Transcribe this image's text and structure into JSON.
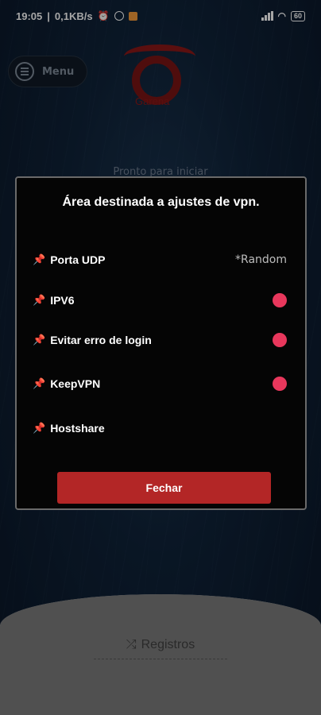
{
  "status_bar": {
    "time": "19:05",
    "network_speed": "0,1KB/s",
    "battery": "60"
  },
  "background": {
    "menu_label": "Menu",
    "logo_text": "Garena",
    "status_text": "Pronto para iniciar",
    "registros_label": "Registros"
  },
  "dialog": {
    "title": "Área destinada a ajustes de vpn.",
    "items": [
      {
        "label": "Porta UDP",
        "value": "*Random"
      },
      {
        "label": "IPV6",
        "enabled": true
      },
      {
        "label": "Evitar erro de login",
        "enabled": true
      },
      {
        "label": "KeepVPN",
        "enabled": true
      },
      {
        "label": "Hostshare"
      }
    ],
    "close_button": "Fechar"
  },
  "colors": {
    "toggle_on": "#e8375c",
    "button": "#b32626"
  }
}
